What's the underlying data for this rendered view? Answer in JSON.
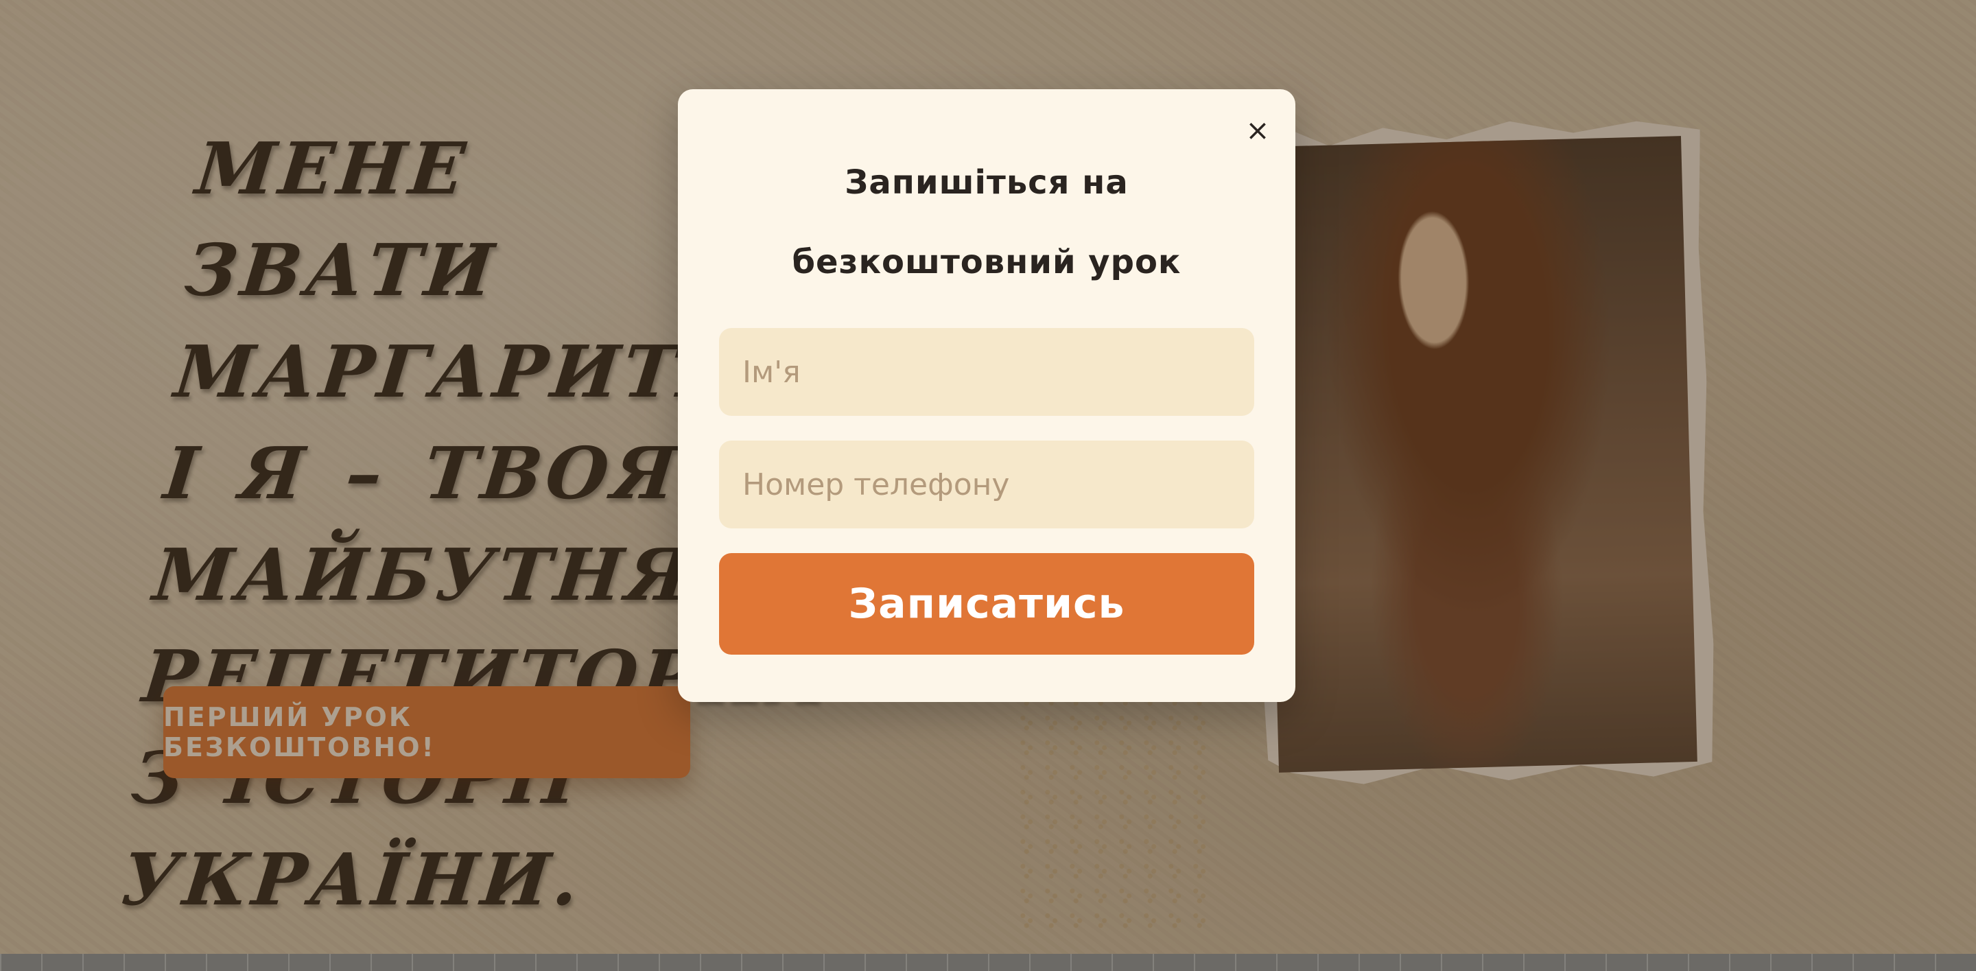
{
  "hero": {
    "headline": "Мене звати Маргарита і я – твоя майбутня репетиторка з історії України.",
    "cta_label": "ПЕРШИЙ УРОК БЕЗКОШТОВНО!"
  },
  "modal": {
    "title": "Запишіться на безкоштовний урок",
    "close_symbol": "×",
    "name_placeholder": "Ім'я",
    "phone_placeholder": "Номер телефону",
    "submit_label": "Записатись"
  },
  "colors": {
    "accent": "#e07636",
    "modal_background": "#fdf6e9",
    "field_background": "#f6e8cb",
    "text_dark": "#2a2420"
  }
}
